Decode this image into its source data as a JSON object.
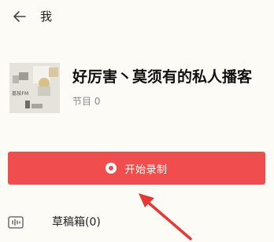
{
  "header": {
    "back_icon": "back-arrow-icon",
    "title": "我"
  },
  "podcast": {
    "cover_text": "荔枝FM",
    "title": "好厉害丶莫须有的私人播客",
    "episode_count": "节目 0"
  },
  "record_button": {
    "icon": "record-icon",
    "label": "开始录制",
    "color": "#f04e4e"
  },
  "drafts": {
    "icon": "waveform-icon",
    "label": "草稿箱(0)"
  },
  "annotation": {
    "arrow_color": "#e53935"
  }
}
